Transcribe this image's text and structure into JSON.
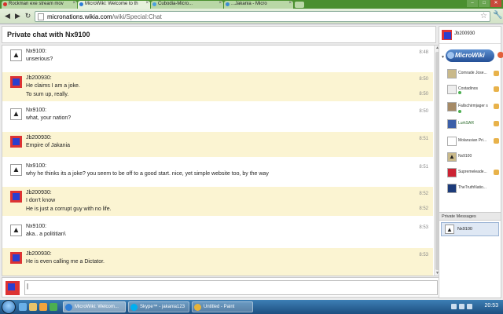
{
  "browser": {
    "tabs": [
      {
        "label": "Rockman exe stream mov",
        "color": "#d9302c"
      },
      {
        "label": "MicroWiki: Welcome to th",
        "color": "#2e7ed6",
        "active": true
      },
      {
        "label": "Cubodia-Micro...",
        "color": "#4aa0e0"
      },
      {
        "label": "...Jakania - Micro",
        "color": "#3b8bd3"
      }
    ],
    "url_domain": "micronations.wikia.com",
    "url_path": "/wiki/Special:Chat",
    "window_min": "–",
    "window_max": "□",
    "window_close": "✕"
  },
  "chat": {
    "title": "Private chat with Nx9100",
    "messages": [
      {
        "user": "Nx9100:",
        "avatar": "star",
        "lines": [
          {
            "text": "unserious?",
            "time": "8:48"
          }
        ]
      },
      {
        "user": "Jb200930:",
        "avatar": "jb",
        "lines": [
          {
            "text": "He claims I am a joke.",
            "time": "8:50"
          },
          {
            "text": "To sum up, really.",
            "time": "8:50"
          }
        ]
      },
      {
        "user": "Nx9100:",
        "avatar": "star",
        "lines": [
          {
            "text": "what, your nation?",
            "time": "8:50"
          }
        ]
      },
      {
        "user": "Jb200930:",
        "avatar": "jb",
        "lines": [
          {
            "text": "Empire of Jakania",
            "time": "8:51"
          }
        ]
      },
      {
        "user": "Nx9100:",
        "avatar": "star",
        "lines": [
          {
            "text": "why he thinks its a joke? you seem to be off to a good start. nice, yet simple website too, by the way",
            "time": "8:51"
          }
        ]
      },
      {
        "user": "Jb200930:",
        "avatar": "jb",
        "lines": [
          {
            "text": "I don't know",
            "time": "8:52"
          },
          {
            "text": "He is just a corrupt guy with no life.",
            "time": "8:52"
          }
        ]
      },
      {
        "user": "Nx9100:",
        "avatar": "star",
        "lines": [
          {
            "text": "aka.. a polititian\\",
            "time": "8:53"
          }
        ]
      },
      {
        "user": "Jb200930:",
        "avatar": "jb",
        "lines": [
          {
            "text": "He is even calling me a Dictator.",
            "time": "8:53"
          }
        ]
      }
    ],
    "input_value": "|"
  },
  "sidebar": {
    "me": "Jb200930",
    "wiki_name": "MicroWiki",
    "users": [
      {
        "name": "Comrade Jose...",
        "online": false
      },
      {
        "name": "Costadinos",
        "online": true
      },
      {
        "name": "Fallschirmjager s",
        "online": true
      },
      {
        "name": "LurkSAR",
        "online": false
      },
      {
        "name": "Molarusian Pri...",
        "online": false
      },
      {
        "name": "Nx9100",
        "online": false
      },
      {
        "name": "Supremeleade...",
        "online": false
      },
      {
        "name": "TheTruthNatio...",
        "online": false
      }
    ],
    "private_messages_label": "Private Messages",
    "pm_user": "Nx9100"
  },
  "taskbar": {
    "tasks": [
      {
        "label": "MicroWiki: Welcom...",
        "color": "#2e7ed6",
        "active": true
      },
      {
        "label": "Skype™ - jakania123",
        "color": "#00aff0"
      },
      {
        "label": "Untitled - Paint",
        "color": "#e5b33a"
      }
    ],
    "clock": "20:53"
  }
}
